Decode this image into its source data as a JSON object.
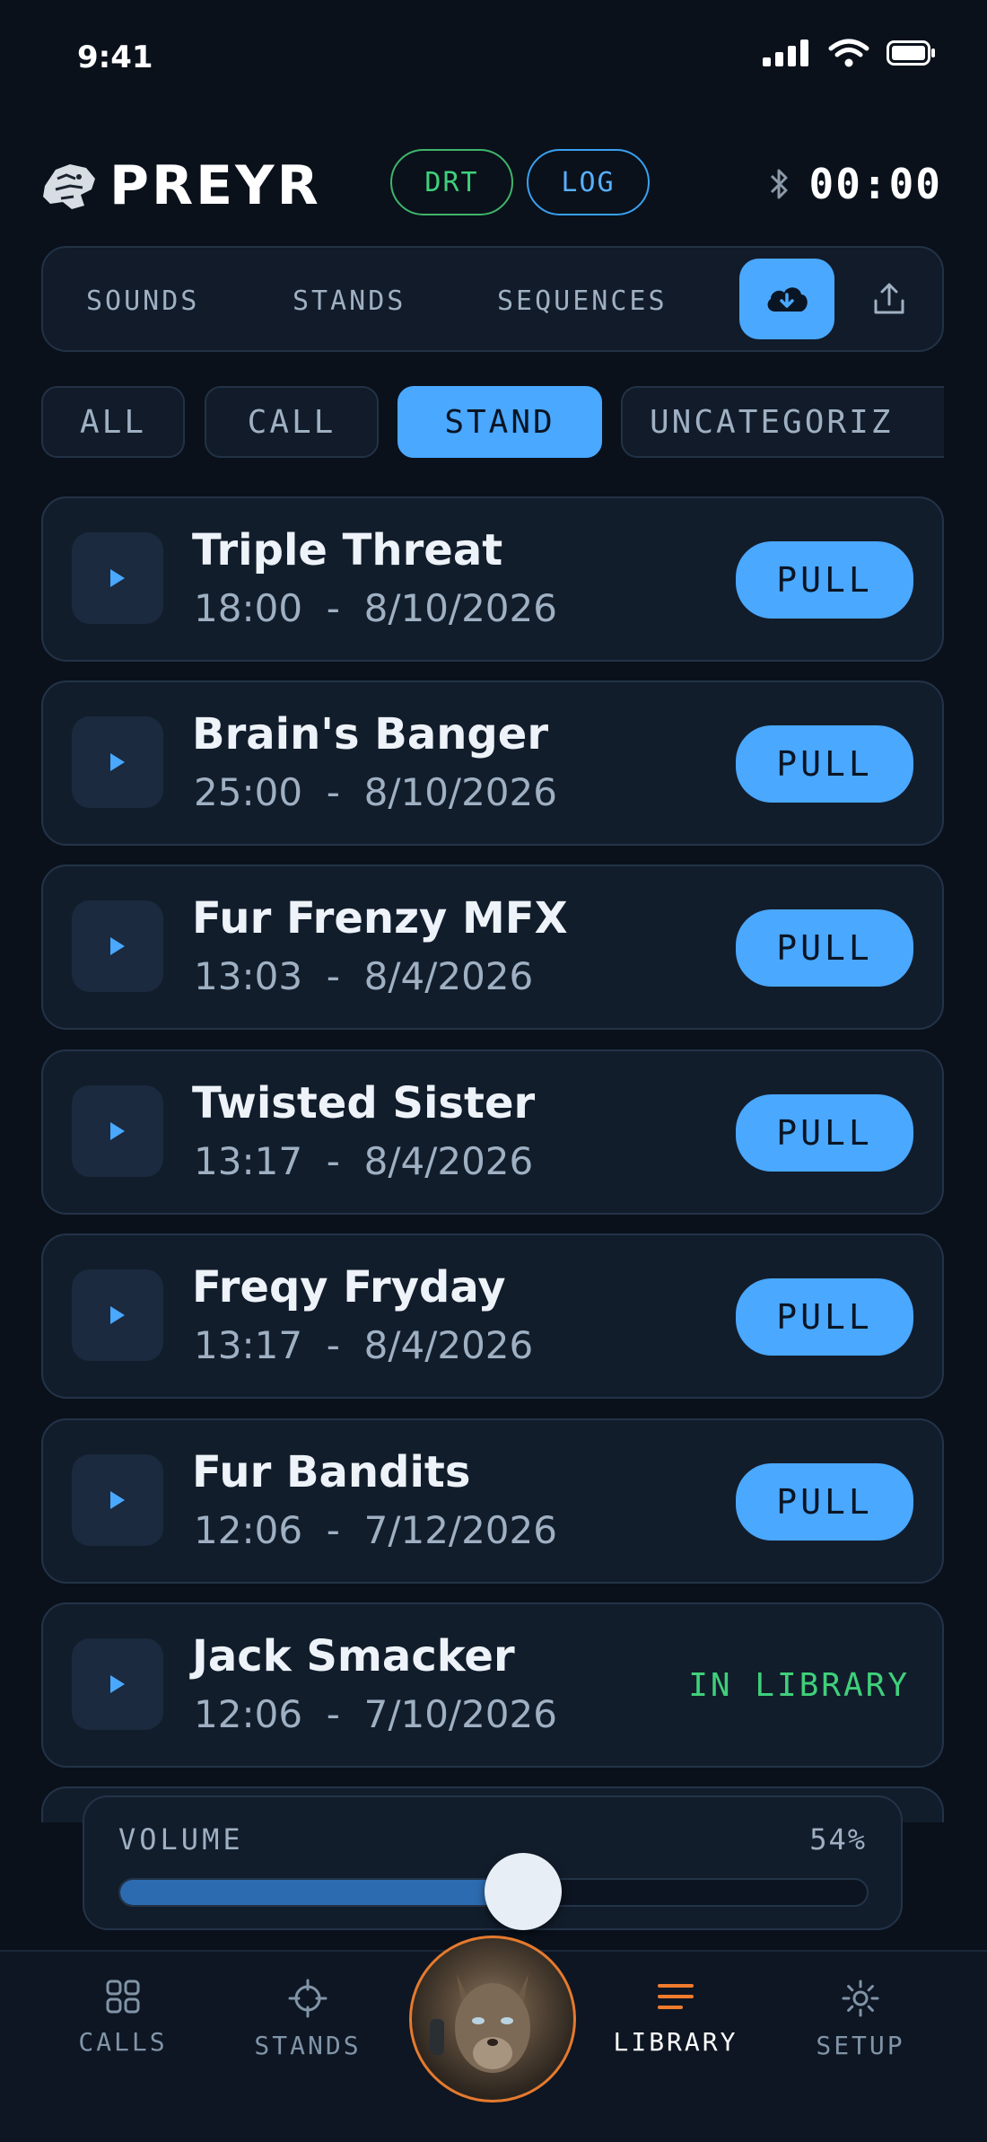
{
  "status_bar": {
    "time": "9:41"
  },
  "header": {
    "app_name": "PREYR",
    "drt_label": "DRT",
    "log_label": "LOG",
    "timer": "00:00"
  },
  "main_tabs": [
    {
      "label": "SOUNDS"
    },
    {
      "label": "STANDS"
    },
    {
      "label": "SEQUENCES"
    }
  ],
  "filters": [
    {
      "label": "ALL",
      "active": false
    },
    {
      "label": "CALL",
      "active": false
    },
    {
      "label": "STAND",
      "active": true
    },
    {
      "label": "UNCATEGORIZ",
      "active": false
    }
  ],
  "items": [
    {
      "title": "Triple Threat",
      "duration": "18:00",
      "date": "8/10/2026",
      "action": "PULL"
    },
    {
      "title": "Brain's Banger",
      "duration": "25:00",
      "date": "8/10/2026",
      "action": "PULL"
    },
    {
      "title": "Fur Frenzy MFX",
      "duration": "13:03",
      "date": "8/4/2026",
      "action": "PULL"
    },
    {
      "title": "Twisted Sister",
      "duration": "13:17",
      "date": "8/4/2026",
      "action": "PULL"
    },
    {
      "title": "Freqy Fryday",
      "duration": "13:17",
      "date": "8/4/2026",
      "action": "PULL"
    },
    {
      "title": "Fur Bandits",
      "duration": "12:06",
      "date": "7/12/2026",
      "action": "PULL"
    },
    {
      "title": "Jack Smacker",
      "duration": "12:06",
      "date": "7/10/2026",
      "status": "IN LIBRARY"
    }
  ],
  "volume": {
    "label": "VOLUME",
    "value_text": "54%",
    "level": 0.54
  },
  "bottom_nav": [
    {
      "label": "CALLS",
      "icon": "grid-icon"
    },
    {
      "label": "STANDS",
      "icon": "crosshair-icon"
    },
    {
      "label": "LIBRARY",
      "icon": "list-icon",
      "active": true
    },
    {
      "label": "SETUP",
      "icon": "gear-icon"
    }
  ],
  "colors": {
    "accent": "#4aa8ff",
    "success": "#3fd07a",
    "active_nav_icon": "#f07b2c",
    "background": "#0a111b"
  }
}
